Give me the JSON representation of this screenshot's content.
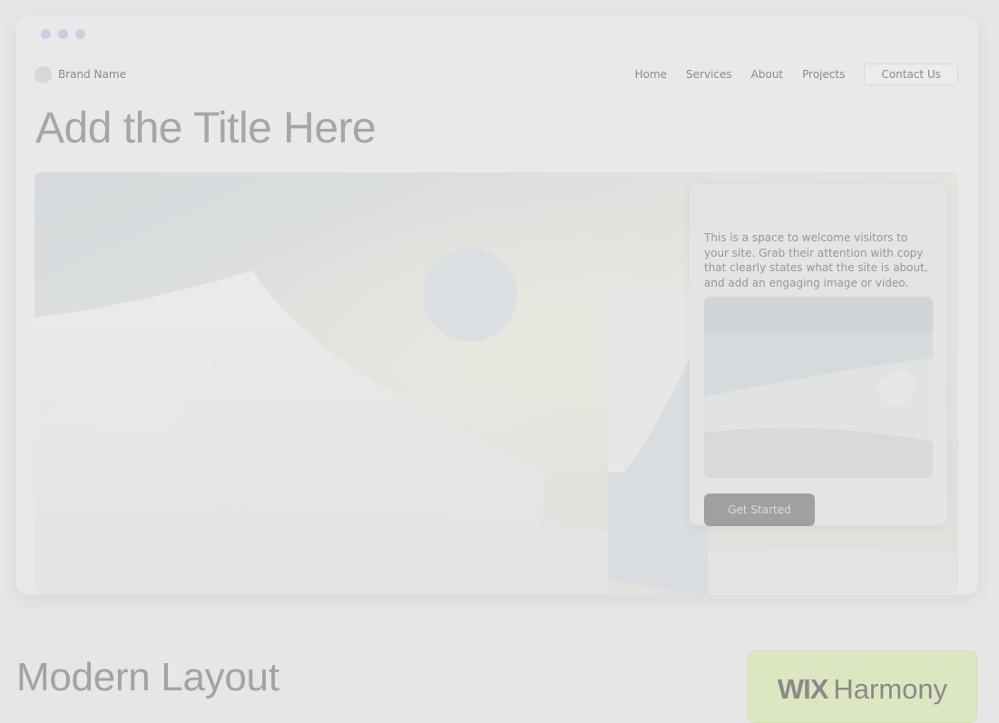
{
  "window": {
    "controls": [
      "dot",
      "dot",
      "dot"
    ]
  },
  "nav": {
    "brand": "Brand Name",
    "items": [
      "Home",
      "Services",
      "About",
      "Projects"
    ],
    "cta": "Contact Us"
  },
  "page": {
    "title": "Add the Title Here"
  },
  "hero": {
    "card_text": "This is a space to welcome visitors to your site. Grab their attention with copy that clearly states what the site is about, and add an engaging image or video.",
    "button": "Get Started"
  },
  "footer": {
    "caption": "Modern Layout",
    "badge_brand": "WIX",
    "badge_product": "Harmony"
  },
  "colors": {
    "background": "#e6e6e6",
    "badge": "#dce7c2",
    "window_dots": "#cfcde2",
    "button": "#a0a0a0"
  }
}
